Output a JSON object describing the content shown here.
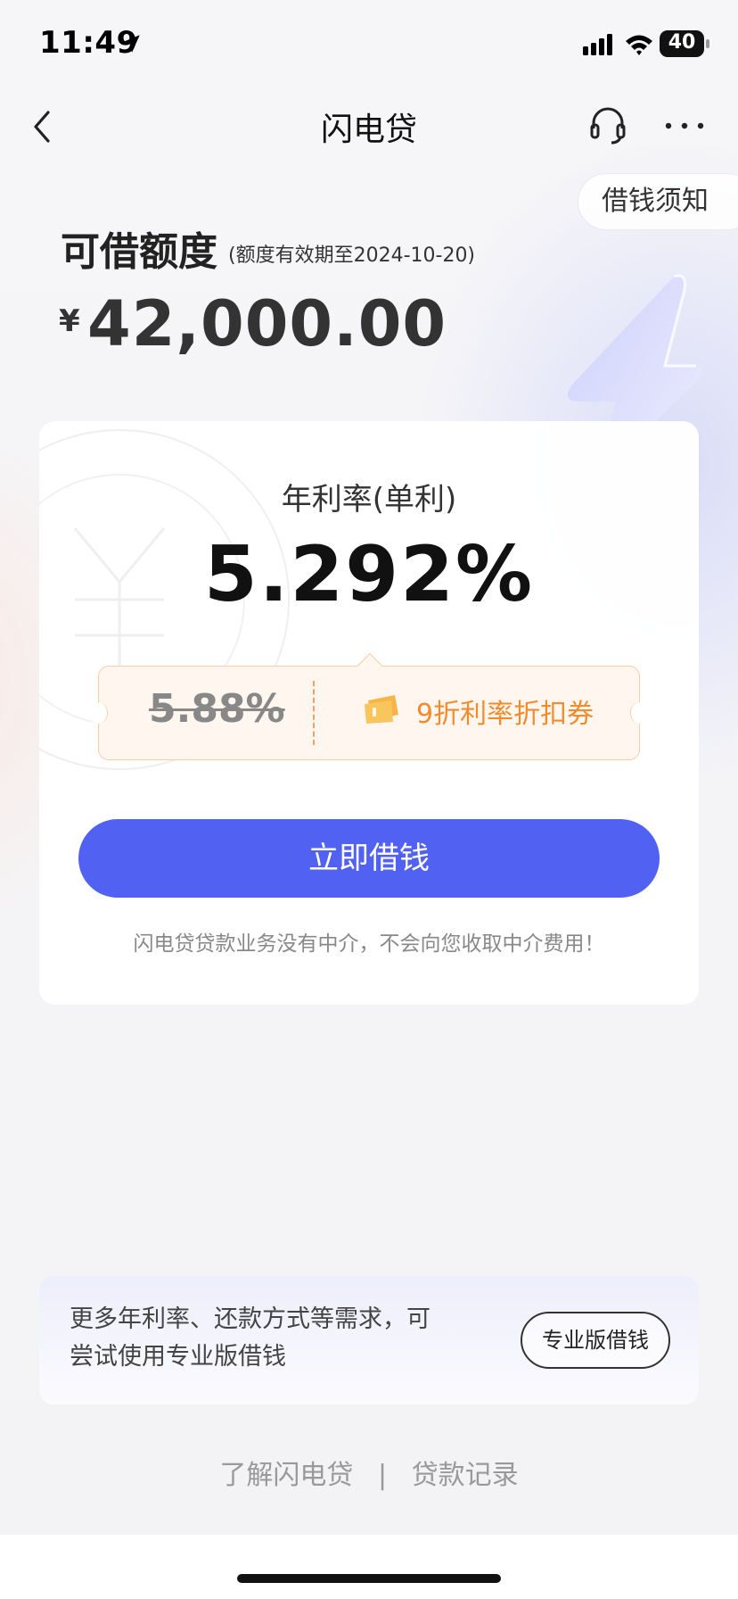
{
  "status_bar": {
    "time": "11:49",
    "battery": "40",
    "icons": [
      "location-arrow-icon",
      "cellular-signal-icon",
      "wifi-icon",
      "battery-icon"
    ]
  },
  "nav": {
    "title": "闪电贷",
    "back_icon": "chevron-left-icon",
    "support_icon": "headset-icon",
    "more_icon": "more-dots-icon"
  },
  "notice_button": "借钱须知",
  "credit": {
    "title": "可借额度",
    "validity": "(额度有效期至2024-10-20)",
    "currency": "¥",
    "amount": "42,000.00"
  },
  "rate": {
    "label": "年利率(单利)",
    "value": "5.292%",
    "original": "5.88%",
    "coupon_label": "9折利率折扣券",
    "coupon_icon": "ticket-icon"
  },
  "borrow_button": "立即借钱",
  "disclaimer": "闪电贷贷款业务没有中介，不会向您收取中介费用！",
  "pro": {
    "text": "更多年利率、还款方式等需求，可尝试使用专业版借钱",
    "button": "专业版借钱"
  },
  "footer": {
    "link1": "了解闪电贷",
    "separator": "|",
    "link2": "贷款记录"
  },
  "colors": {
    "primary": "#5162f2",
    "coupon_orange": "#f28b2c",
    "coupon_bg": "#fff6ef"
  }
}
